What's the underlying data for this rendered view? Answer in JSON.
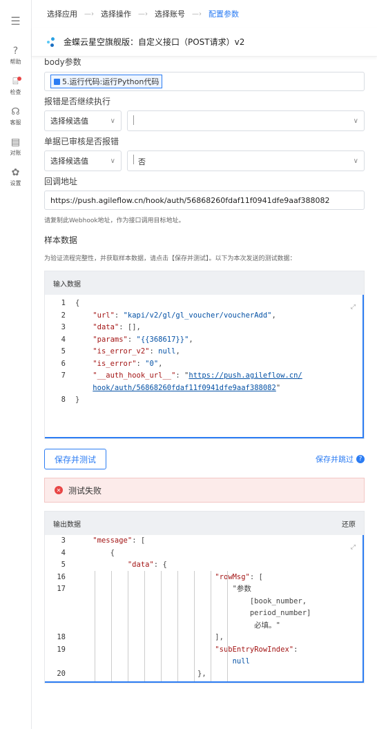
{
  "sidebar": {
    "items": [
      {
        "icon": "help-icon",
        "glyph": "?",
        "label": "帮助"
      },
      {
        "icon": "inspect-icon",
        "glyph": "⌸",
        "label": "检查"
      },
      {
        "icon": "support-icon",
        "glyph": "☊",
        "label": "客服"
      },
      {
        "icon": "reconcile-icon",
        "glyph": "▤",
        "label": "对账"
      },
      {
        "icon": "gear-icon",
        "glyph": "✿",
        "label": "设置"
      }
    ]
  },
  "steps": [
    "选择应用",
    "选择操作",
    "选择账号",
    "配置参数"
  ],
  "title": "金蝶云星空旗舰版：自定义接口（POST请求）v2",
  "body": {
    "label": "body参数",
    "chip": "5.运行代码:运行Python代码"
  },
  "continue_on_error": {
    "label": "报错是否继续执行",
    "select_placeholder": "选择候选值",
    "value": ""
  },
  "audited_error": {
    "label": "单据已审核是否报错",
    "select_placeholder": "选择候选值",
    "value": "否"
  },
  "callback": {
    "label": "回调地址",
    "url": "https://push.agileflow.cn/hook/auth/56868260fdaf11f0941dfe9aaf388082",
    "hint": "请复制此Webhook地址，作为接口调用目标地址。"
  },
  "sample": {
    "title": "样本数据",
    "desc": "为验证流程完整性，并获取样本数据，请点击【保存并测试】。以下为本次发送的测试数据："
  },
  "input_panel": {
    "header": "输入数据",
    "lines": [
      {
        "no": "1",
        "text": "{"
      },
      {
        "no": "2",
        "text": "    \"url\": \"kapi/v2/gl/gl_voucher/voucherAdd\","
      },
      {
        "no": "3",
        "text": "    \"data\": [],"
      },
      {
        "no": "4",
        "text": "    \"params\": \"{{368617}}\","
      },
      {
        "no": "5",
        "text": "    \"is_error_v2\": null,"
      },
      {
        "no": "6",
        "text": "    \"is_error\": \"0\","
      },
      {
        "no": "7",
        "text": "    \"__auth_hook_url__\": \"https://push.agileflow.cn/"
      },
      {
        "no": "",
        "text": "    hook/auth/56868260fdaf11f0941dfe9aaf388082\""
      },
      {
        "no": "8",
        "text": "}"
      }
    ]
  },
  "actions": {
    "save_test": "保存并测试",
    "save_skip": "保存并跳过"
  },
  "error": "测试失败",
  "output_panel": {
    "header": "输出数据",
    "restore": "还原",
    "lines": [
      {
        "no": "3",
        "text": "    \"message\": ["
      },
      {
        "no": "4",
        "text": "        {"
      },
      {
        "no": "5",
        "text": "            \"data\": {"
      },
      {
        "no": "16",
        "text": "                                \"rowMsg\": ["
      },
      {
        "no": "17",
        "text": "                                    \"参数"
      },
      {
        "no": "",
        "text": "                                        [book_number,"
      },
      {
        "no": "",
        "text": "                                        period_number]"
      },
      {
        "no": "",
        "text": "                                         必填。\""
      },
      {
        "no": "18",
        "text": "                                ],"
      },
      {
        "no": "19",
        "text": "                                \"subEntryRowIndex\":"
      },
      {
        "no": "",
        "text": "                                    null"
      },
      {
        "no": "20",
        "text": "                            },"
      }
    ]
  }
}
